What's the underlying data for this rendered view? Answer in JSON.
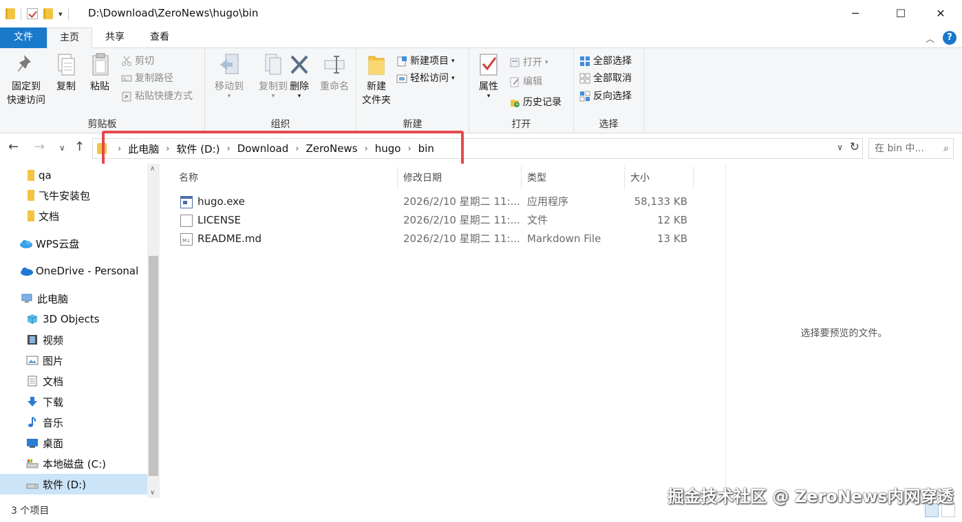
{
  "window": {
    "title_path": "D:\\Download\\ZeroNews\\hugo\\bin",
    "minimize": "─",
    "maximize": "☐",
    "close": "✕"
  },
  "ribbon_tabs": {
    "file": "文件",
    "home": "主页",
    "share": "共享",
    "view": "查看"
  },
  "ribbon": {
    "clipboard": {
      "label": "剪贴板",
      "pin": "固定到\n快速访问",
      "pin_line1": "固定到",
      "pin_line2": "快速访问",
      "copy": "复制",
      "paste": "粘贴",
      "cut": "剪切",
      "copy_path": "复制路径",
      "paste_shortcut": "粘贴快捷方式"
    },
    "organize": {
      "label": "组织",
      "move_to": "移动到",
      "copy_to": "复制到",
      "delete": "删除",
      "rename": "重命名"
    },
    "new": {
      "label": "新建",
      "new_folder_line1": "新建",
      "new_folder_line2": "文件夹",
      "new_item": "新建项目",
      "easy_access": "轻松访问"
    },
    "open": {
      "label": "打开",
      "properties": "属性",
      "open": "打开",
      "edit": "编辑",
      "history": "历史记录"
    },
    "select": {
      "label": "选择",
      "select_all": "全部选择",
      "select_none": "全部取消",
      "invert": "反向选择"
    }
  },
  "address": {
    "crumbs": [
      "此电脑",
      "软件 (D:)",
      "Download",
      "ZeroNews",
      "hugo",
      "bin"
    ],
    "search_placeholder": "在 bin 中..."
  },
  "nav_items": [
    {
      "label": "qa",
      "icon": "folder-icon"
    },
    {
      "label": "飞牛安装包",
      "icon": "folder-icon"
    },
    {
      "label": "文档",
      "icon": "folder-icon"
    },
    {
      "label": "WPS云盘",
      "icon": "cloud-icon"
    },
    {
      "label": "OneDrive - Personal",
      "icon": "onedrive-icon"
    },
    {
      "label": "此电脑",
      "icon": "computer-icon"
    },
    {
      "label": "3D Objects",
      "icon": "cube-icon"
    },
    {
      "label": "视频",
      "icon": "video-icon"
    },
    {
      "label": "图片",
      "icon": "picture-icon"
    },
    {
      "label": "文档",
      "icon": "document-icon"
    },
    {
      "label": "下载",
      "icon": "download-icon"
    },
    {
      "label": "音乐",
      "icon": "music-icon"
    },
    {
      "label": "桌面",
      "icon": "desktop-icon"
    },
    {
      "label": "本地磁盘 (C:)",
      "icon": "drive-icon"
    },
    {
      "label": "软件 (D:)",
      "icon": "drive-icon"
    }
  ],
  "columns": {
    "name": "名称",
    "modified": "修改日期",
    "type": "类型",
    "size": "大小"
  },
  "files": [
    {
      "name": "hugo.exe",
      "modified": "2026/2/10 星期二 11:...",
      "type": "应用程序",
      "size": "58,133 KB",
      "icon": "exe-icon"
    },
    {
      "name": "LICENSE",
      "modified": "2026/2/10 星期二 11:...",
      "type": "文件",
      "size": "12 KB",
      "icon": "file-icon"
    },
    {
      "name": "README.md",
      "modified": "2026/2/10 星期二 11:...",
      "type": "Markdown File",
      "size": "13 KB",
      "icon": "markdown-icon"
    }
  ],
  "preview": {
    "empty_text": "选择要预览的文件。"
  },
  "status": {
    "count": "3 个项目"
  },
  "watermark": "掘金技术社区 @ ZeroNews内网穿透",
  "colors": {
    "accent": "#1979ca",
    "highlight_box": "#e5484d",
    "selected_nav": "#cce4f7"
  }
}
